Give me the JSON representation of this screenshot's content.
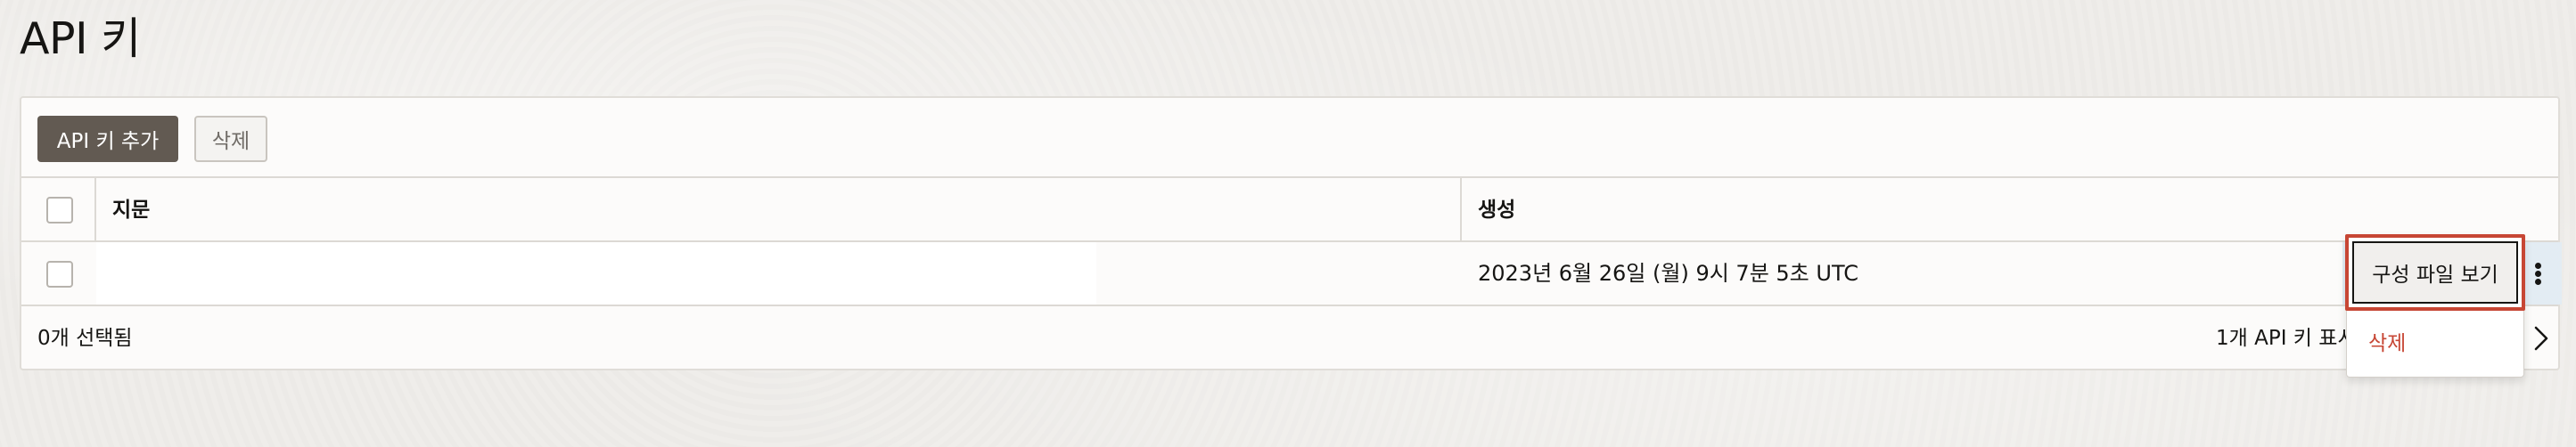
{
  "page": {
    "title": "API 키"
  },
  "toolbar": {
    "add_label": "API 키 추가",
    "delete_label": "삭제"
  },
  "table": {
    "columns": [
      "지문",
      "생성"
    ],
    "rows": [
      {
        "fingerprint": "",
        "created": "2023년 6월 26일 (월) 9시 7분 5초 UTC"
      }
    ]
  },
  "footer": {
    "selected": "0개 선택됨",
    "showing": "1개 API 키 표시 중"
  },
  "row_menu": {
    "items": [
      "구성 파일 보기",
      "삭제"
    ]
  },
  "colors": {
    "primary_button": "#625a52",
    "danger_text": "#c74634",
    "highlight_border": "#c74634",
    "row_action_bg": "#e3ecf3"
  },
  "icons": {
    "kebab": "more-vertical-icon",
    "next": "chevron-right-icon"
  }
}
